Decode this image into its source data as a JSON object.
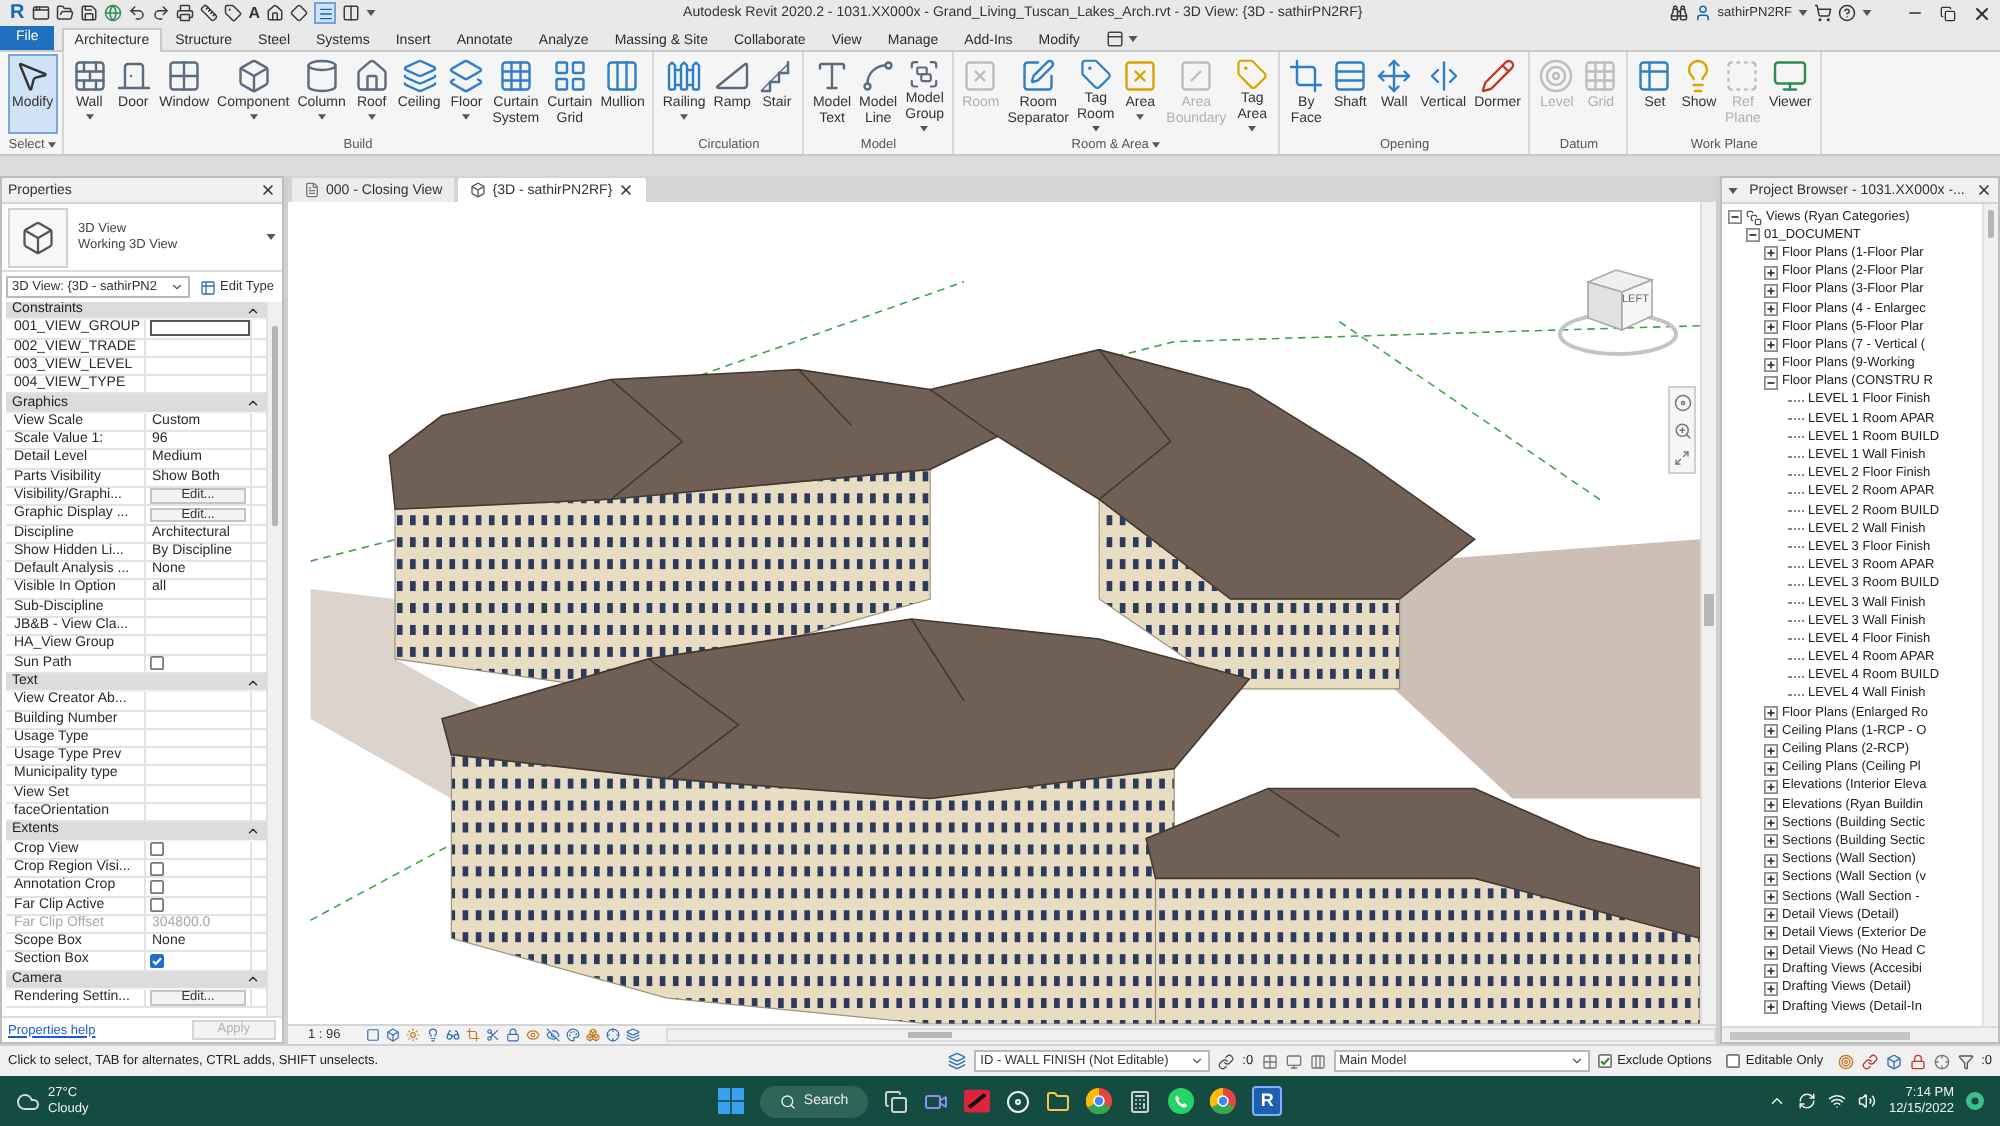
{
  "title_bar": {
    "logo": "R",
    "text_tool": "A",
    "title": "Autodesk Revit 2020.2 - 1031.XX000x - Grand_Living_Tuscan_Lakes_Arch.rvt - 3D View: {3D - sathirPN2RF}",
    "user": "sathirPN2RF"
  },
  "ribbon_tabs": {
    "file": "File",
    "tabs": [
      {
        "label": "Architecture",
        "selected": true
      },
      {
        "label": "Structure",
        "selected": false
      },
      {
        "label": "Steel",
        "selected": false
      },
      {
        "label": "Systems",
        "selected": false
      },
      {
        "label": "Insert",
        "selected": false
      },
      {
        "label": "Annotate",
        "selected": false
      },
      {
        "label": "Analyze",
        "selected": false
      },
      {
        "label": "Massing & Site",
        "selected": false
      },
      {
        "label": "Collaborate",
        "selected": false
      },
      {
        "label": "View",
        "selected": false
      },
      {
        "label": "Manage",
        "selected": false
      },
      {
        "label": "Add-Ins",
        "selected": false
      },
      {
        "label": "Modify",
        "selected": false
      }
    ]
  },
  "ribbon": {
    "groups": [
      {
        "label": "Select",
        "dropdown": true,
        "buttons": [
          {
            "label": "Modify",
            "dropdown": false,
            "disabled": false,
            "active": true
          }
        ]
      },
      {
        "label": "Build",
        "dropdown": false,
        "buttons": [
          {
            "label": "Wall",
            "dropdown": true,
            "disabled": false,
            "active": false
          },
          {
            "label": "Door",
            "dropdown": false,
            "disabled": false,
            "active": false
          },
          {
            "label": "Window",
            "dropdown": false,
            "disabled": false,
            "active": false
          },
          {
            "label": "Component",
            "dropdown": true,
            "disabled": false,
            "active": false
          },
          {
            "label": "Column",
            "dropdown": true,
            "disabled": false,
            "active": false
          },
          {
            "label": "Roof",
            "dropdown": true,
            "disabled": false,
            "active": false
          },
          {
            "label": "Ceiling",
            "dropdown": false,
            "disabled": false,
            "active": false
          },
          {
            "label": "Floor",
            "dropdown": true,
            "disabled": false,
            "active": false
          },
          {
            "label": "Curtain System",
            "dropdown": false,
            "disabled": false,
            "active": false
          },
          {
            "label": "Curtain Grid",
            "dropdown": false,
            "disabled": false,
            "active": false
          },
          {
            "label": "Mullion",
            "dropdown": false,
            "disabled": false,
            "active": false
          }
        ]
      },
      {
        "label": "Circulation",
        "dropdown": false,
        "buttons": [
          {
            "label": "Railing",
            "dropdown": true,
            "disabled": false,
            "active": false
          },
          {
            "label": "Ramp",
            "dropdown": false,
            "disabled": false,
            "active": false
          },
          {
            "label": "Stair",
            "dropdown": false,
            "disabled": false,
            "active": false
          }
        ]
      },
      {
        "label": "Model",
        "dropdown": false,
        "buttons": [
          {
            "label": "Model Text",
            "dropdown": false,
            "disabled": false,
            "active": false
          },
          {
            "label": "Model Line",
            "dropdown": false,
            "disabled": false,
            "active": false
          },
          {
            "label": "Model Group",
            "dropdown": true,
            "disabled": false,
            "active": false
          }
        ]
      },
      {
        "label": "Room & Area",
        "dropdown": true,
        "buttons": [
          {
            "label": "Room",
            "dropdown": false,
            "disabled": true,
            "active": false
          },
          {
            "label": "Room Separator",
            "dropdown": false,
            "disabled": false,
            "active": false
          },
          {
            "label": "Tag Room",
            "dropdown": true,
            "disabled": false,
            "active": false
          },
          {
            "label": "Area",
            "dropdown": true,
            "disabled": false,
            "active": false
          },
          {
            "label": "Area Boundary",
            "dropdown": false,
            "disabled": true,
            "active": false
          },
          {
            "label": "Tag Area",
            "dropdown": true,
            "disabled": false,
            "active": false
          }
        ]
      },
      {
        "label": "Opening",
        "dropdown": false,
        "buttons": [
          {
            "label": "By Face",
            "dropdown": false,
            "disabled": false,
            "active": false
          },
          {
            "label": "Shaft",
            "dropdown": false,
            "disabled": false,
            "active": false
          },
          {
            "label": "Wall",
            "dropdown": false,
            "disabled": false,
            "active": false
          },
          {
            "label": "Vertical",
            "dropdown": false,
            "disabled": false,
            "active": false
          },
          {
            "label": "Dormer",
            "dropdown": false,
            "disabled": false,
            "active": false
          }
        ]
      },
      {
        "label": "Datum",
        "dropdown": false,
        "buttons": [
          {
            "label": "Level",
            "dropdown": false,
            "disabled": true,
            "active": false
          },
          {
            "label": "Grid",
            "dropdown": false,
            "disabled": true,
            "active": false
          }
        ]
      },
      {
        "label": "Work Plane",
        "dropdown": false,
        "buttons": [
          {
            "label": "Set",
            "dropdown": false,
            "disabled": false,
            "active": false
          },
          {
            "label": "Show",
            "dropdown": false,
            "disabled": false,
            "active": false
          },
          {
            "label": "Ref Plane",
            "dropdown": false,
            "disabled": true,
            "active": false
          },
          {
            "label": "Viewer",
            "dropdown": false,
            "disabled": false,
            "active": false
          }
        ]
      }
    ]
  },
  "properties": {
    "title": "Properties",
    "type_name": "3D View",
    "type_subname": "Working 3D View",
    "instance_selector": "3D View: {3D - sathirPN2",
    "edit_type": "Edit Type",
    "groups": [
      {
        "label": "Constraints",
        "expanded": true,
        "rows": [
          {
            "label": "001_VIEW_GROUP",
            "kind": "field"
          },
          {
            "label": "002_VIEW_TRADE",
            "kind": "empty"
          },
          {
            "label": "003_VIEW_LEVEL",
            "kind": "empty"
          },
          {
            "label": "004_VIEW_TYPE",
            "kind": "empty"
          }
        ]
      },
      {
        "label": "Graphics",
        "expanded": true,
        "rows": [
          {
            "label": "View Scale",
            "kind": "text",
            "value": "Custom"
          },
          {
            "label": "Scale Value 1:",
            "kind": "text",
            "value": "96"
          },
          {
            "label": "Detail Level",
            "kind": "text",
            "value": "Medium"
          },
          {
            "label": "Parts Visibility",
            "kind": "text",
            "value": "Show Both"
          },
          {
            "label": "Visibility/Graphi...",
            "kind": "button",
            "value": "Edit..."
          },
          {
            "label": "Graphic Display ...",
            "kind": "button",
            "value": "Edit..."
          },
          {
            "label": "Discipline",
            "kind": "text",
            "value": "Architectural"
          },
          {
            "label": "Show Hidden Li...",
            "kind": "text",
            "value": "By Discipline"
          },
          {
            "label": "Default Analysis ...",
            "kind": "text",
            "value": "None"
          },
          {
            "label": "Visible In Option",
            "kind": "text",
            "value": "all"
          },
          {
            "label": "Sub-Discipline",
            "kind": "empty"
          },
          {
            "label": "JB&B - View Cla...",
            "kind": "empty"
          },
          {
            "label": "HA_View Group",
            "kind": "empty"
          },
          {
            "label": "Sun Path",
            "kind": "checkbox",
            "checked": false
          }
        ]
      },
      {
        "label": "Text",
        "expanded": true,
        "rows": [
          {
            "label": "View Creator Ab...",
            "kind": "empty"
          },
          {
            "label": "Building Number",
            "kind": "empty"
          },
          {
            "label": "Usage Type",
            "kind": "empty"
          },
          {
            "label": "Usage Type Prev",
            "kind": "empty"
          },
          {
            "label": "Municipality type",
            "kind": "empty"
          },
          {
            "label": "View Set",
            "kind": "empty"
          },
          {
            "label": "faceOrientation",
            "kind": "empty"
          }
        ]
      },
      {
        "label": "Extents",
        "expanded": true,
        "rows": [
          {
            "label": "Crop View",
            "kind": "checkbox",
            "checked": false
          },
          {
            "label": "Crop Region Visi...",
            "kind": "checkbox",
            "checked": false
          },
          {
            "label": "Annotation Crop",
            "kind": "checkbox",
            "checked": false
          },
          {
            "label": "Far Clip Active",
            "kind": "checkbox",
            "checked": false
          },
          {
            "label": "Far Clip Offset",
            "kind": "disabled",
            "value": "304800.0"
          },
          {
            "label": "Scope Box",
            "kind": "text",
            "value": "None"
          },
          {
            "label": "Section Box",
            "kind": "checkbox",
            "checked": true
          }
        ]
      },
      {
        "label": "Camera",
        "expanded": true,
        "rows": [
          {
            "label": "Rendering Settin...",
            "kind": "button",
            "value": "Edit..."
          }
        ]
      }
    ],
    "help_link": "Properties help",
    "apply": {
      "label": "Apply",
      "disabled": true
    }
  },
  "view_tabs": [
    {
      "label": "000 - Closing View",
      "selected": false
    },
    {
      "label": "{3D - sathirPN2RF}",
      "selected": true
    }
  ],
  "viewport": {
    "view_cube_face": "LEFT"
  },
  "view_bar": {
    "scale": "1 : 96"
  },
  "project_browser": {
    "title": "Project Browser - 1031.XX000x -...",
    "tree": [
      {
        "label": "Views (Ryan Categories)",
        "expanded": true,
        "children": [
          {
            "label": "01_DOCUMENT",
            "expanded": true,
            "children": [
              {
                "label": "Floor Plans (1-Floor Plar",
                "expanded": false
              },
              {
                "label": "Floor Plans (2-Floor Plar",
                "expanded": false
              },
              {
                "label": "Floor Plans (3-Floor Plar",
                "expanded": false
              },
              {
                "label": "Floor Plans (4 - Enlargec",
                "expanded": false
              },
              {
                "label": "Floor Plans (5-Floor Plar",
                "expanded": false
              },
              {
                "label": "Floor Plans (7 - Vertical (",
                "expanded": false
              },
              {
                "label": "Floor Plans (9-Working",
                "expanded": false
              },
              {
                "label": "Floor Plans (CONSTRU R",
                "expanded": true,
                "children": [
                  {
                    "label": "LEVEL 1 Floor Finish"
                  },
                  {
                    "label": "LEVEL 1 Room APAR"
                  },
                  {
                    "label": "LEVEL 1 Room BUILD"
                  },
                  {
                    "label": "LEVEL 1 Wall Finish"
                  },
                  {
                    "label": "LEVEL 2 Floor Finish"
                  },
                  {
                    "label": "LEVEL 2 Room APAR"
                  },
                  {
                    "label": "LEVEL 2 Room BUILD"
                  },
                  {
                    "label": "LEVEL 2 Wall Finish"
                  },
                  {
                    "label": "LEVEL 3 Floor Finish"
                  },
                  {
                    "label": "LEVEL 3 Room APAR"
                  },
                  {
                    "label": "LEVEL 3 Room BUILD"
                  },
                  {
                    "label": "LEVEL 3 Wall Finish"
                  },
                  {
                    "label": "LEVEL 3 Wall Finish"
                  },
                  {
                    "label": "LEVEL 4 Floor Finish"
                  },
                  {
                    "label": "LEVEL 4 Room APAR"
                  },
                  {
                    "label": "LEVEL 4 Room BUILD"
                  },
                  {
                    "label": "LEVEL 4 Wall Finish"
                  }
                ]
              },
              {
                "label": "Floor Plans (Enlarged Ro",
                "expanded": false
              },
              {
                "label": "Ceiling Plans (1-RCP - O",
                "expanded": false
              },
              {
                "label": "Ceiling Plans (2-RCP)",
                "expanded": false
              },
              {
                "label": "Ceiling Plans (Ceiling Pl",
                "expanded": false
              },
              {
                "label": "Elevations (Interior Eleva",
                "expanded": false
              },
              {
                "label": "Elevations (Ryan Buildin",
                "expanded": false
              },
              {
                "label": "Sections (Building Sectic",
                "expanded": false
              },
              {
                "label": "Sections (Building Sectic",
                "expanded": false
              },
              {
                "label": "Sections (Wall Section)",
                "expanded": false
              },
              {
                "label": "Sections (Wall Section (v",
                "expanded": false
              },
              {
                "label": "Sections (Wall Section -",
                "expanded": false
              },
              {
                "label": "Detail Views (Detail)",
                "expanded": false
              },
              {
                "label": "Detail Views (Exterior De",
                "expanded": false
              },
              {
                "label": "Detail Views (No Head C",
                "expanded": false
              },
              {
                "label": "Drafting Views (Accesibi",
                "expanded": false
              },
              {
                "label": "Drafting Views (Detail)",
                "expanded": false
              },
              {
                "label": "Drafting Views (Detail-In",
                "expanded": false
              }
            ]
          }
        ]
      }
    ]
  },
  "status_bar": {
    "hint": "Click to select, TAB for alternates, CTRL adds, SHIFT unselects.",
    "workset": "ID - WALL FINISH (Not Editable)",
    "editable_count": ":0",
    "design_option": "Main Model",
    "exclude_options": {
      "label": "Exclude Options",
      "checked": true
    },
    "editable_only": {
      "label": "Editable Only",
      "checked": false
    },
    "filter_count": ":0"
  },
  "taskbar": {
    "temperature": "27°C",
    "weather": "Cloudy",
    "search": "Search",
    "app_letter": "R",
    "time": "7:14 PM",
    "date": "12/15/2022"
  }
}
